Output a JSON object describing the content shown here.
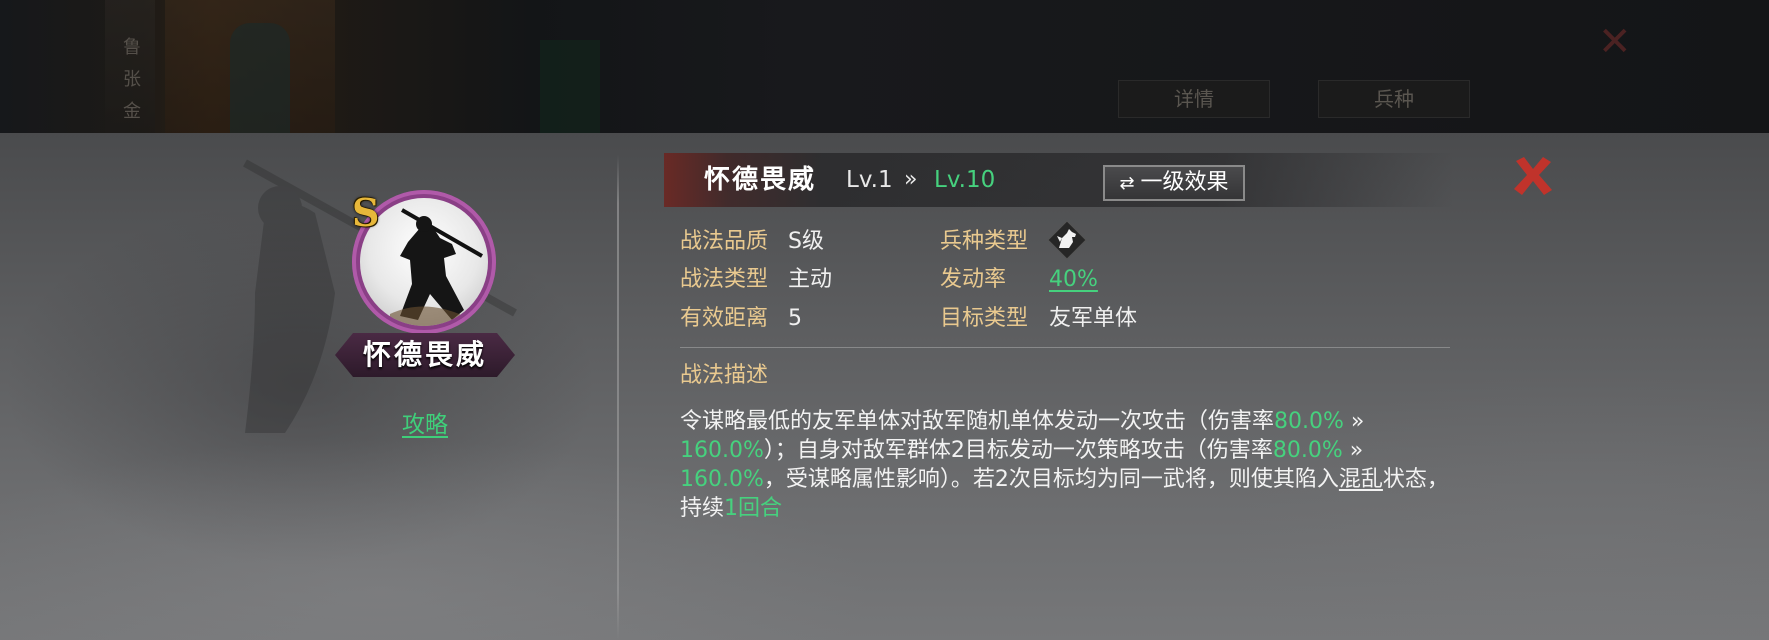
{
  "background": {
    "tabs": [
      "详情",
      "兵种"
    ],
    "side_text": "鲁\n张\n金"
  },
  "portrait": {
    "grade": "S",
    "name": "怀德畏威",
    "strategy_link": "攻略",
    "ring_color": "#b05aa9"
  },
  "header": {
    "skill_name": "怀德畏威",
    "level_current": "Lv.1",
    "level_arrow": "»",
    "level_max": "Lv.10",
    "effect_button": "一级效果",
    "effect_button_icon": "swap-icon",
    "close_icon": "close-x-icon"
  },
  "attributes": {
    "quality_label": "战法品质",
    "quality_value": "S级",
    "type_label": "战法类型",
    "type_value": "主动",
    "range_label": "有效距离",
    "range_value": "5",
    "troop_label": "兵种类型",
    "troop_icon": "cavalry-horse-icon",
    "rate_label": "发动率",
    "rate_value": "40%",
    "target_label": "目标类型",
    "target_value": "友军单体"
  },
  "description": {
    "title": "战法描述",
    "t1": "令谋略最低的友军单体对敌军随机单体发动一次攻击（伤害率",
    "v1": "80.0%",
    "a1": " » ",
    "v2": "160.0%",
    "t2": "）；自身对敌军群体2目标发动一次策略攻击（伤害率",
    "v3": "80.0%",
    "a2": " » ",
    "v4": "160.0%",
    "t3": "，受谋略属性影响）。若2次目标均为同一武将，则使其陷入",
    "status": "混乱",
    "t4": "状态，持续",
    "v5": "1回合"
  },
  "colors": {
    "accent_green": "#46d17e",
    "label_gold": "#e9c98f",
    "close_red": "#c0332b"
  }
}
